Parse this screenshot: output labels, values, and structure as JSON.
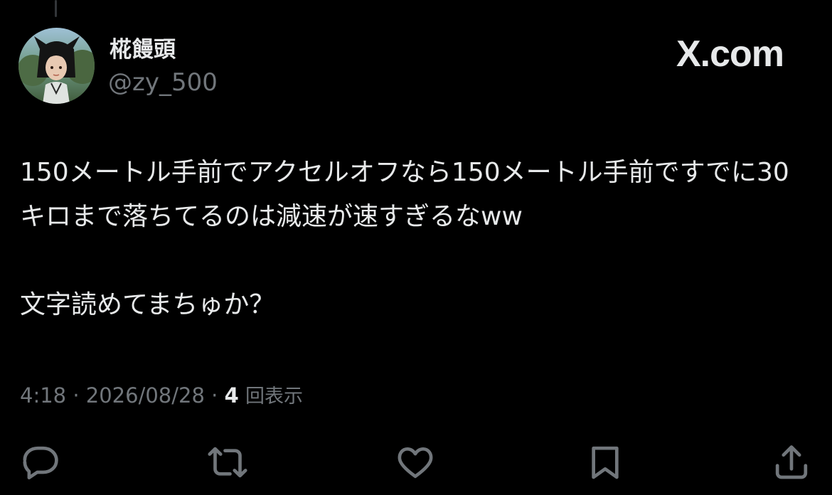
{
  "author": {
    "display_name": "椛饅頭",
    "handle": "@zy_500",
    "avatar": "avatar-image"
  },
  "brand": {
    "label": "X.com"
  },
  "tweet": {
    "text": "150メートル手前でアクセルオフなら150メートル手前ですでに30キロまで落ちてるのは減速が速すぎるなww\n\n文字読めてまちゅか？"
  },
  "meta": {
    "time": "4:18",
    "separator": "·",
    "date": "2026/08/28",
    "views_count": "4",
    "views_label": "回表示"
  },
  "actions": {
    "reply_icon": "reply-icon",
    "repost_icon": "repost-icon",
    "like_icon": "like-icon",
    "bookmark_icon": "bookmark-icon",
    "share_icon": "share-icon"
  },
  "colors": {
    "background": "#000000",
    "primary_text": "#e7e9ea",
    "secondary_text": "#71767b"
  }
}
